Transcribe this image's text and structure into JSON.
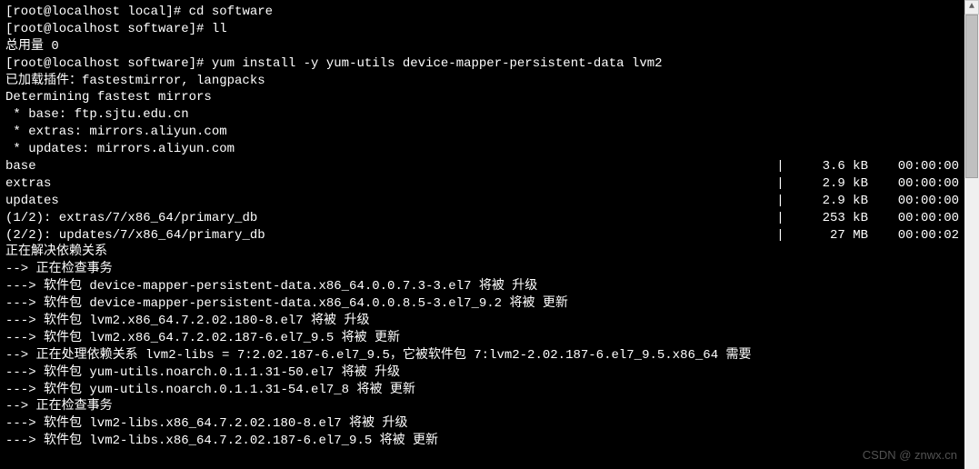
{
  "prompts": {
    "p1_prefix": "[root@localhost local]# ",
    "p1_cmd": "cd software",
    "p2_prefix": "[root@localhost software]# ",
    "p2_cmd": "ll",
    "p3_prefix": "[root@localhost software]# ",
    "p3_cmd": "yum install -y yum-utils device-mapper-persistent-data lvm2"
  },
  "total_usage": "总用量 0",
  "plugins": "已加载插件：fastestmirror, langpacks",
  "determining": "Determining fastest mirrors",
  "mirrors": [
    " * base: ftp.sjtu.edu.cn",
    " * extras: mirrors.aliyun.com",
    " * updates: mirrors.aliyun.com"
  ],
  "repos": [
    {
      "name": "base",
      "size": "3.6 kB",
      "time": "00:00:00"
    },
    {
      "name": "extras",
      "size": "2.9 kB",
      "time": "00:00:00"
    },
    {
      "name": "updates",
      "size": "2.9 kB",
      "time": "00:00:00"
    },
    {
      "name": "(1/2): extras/7/x86_64/primary_db",
      "size": "253 kB",
      "time": "00:00:00"
    },
    {
      "name": "(2/2): updates/7/x86_64/primary_db",
      "size": "27 MB",
      "time": "00:00:02"
    }
  ],
  "resolving": "正在解决依赖关系",
  "trans_check1": "--> 正在检查事务",
  "pkg_lines": [
    "---> 软件包 device-mapper-persistent-data.x86_64.0.0.7.3-3.el7 将被 升级",
    "---> 软件包 device-mapper-persistent-data.x86_64.0.0.8.5-3.el7_9.2 将被 更新",
    "---> 软件包 lvm2.x86_64.7.2.02.180-8.el7 将被 升级",
    "---> 软件包 lvm2.x86_64.7.2.02.187-6.el7_9.5 将被 更新",
    "--> 正在处理依赖关系 lvm2-libs = 7:2.02.187-6.el7_9.5，它被软件包 7:lvm2-2.02.187-6.el7_9.5.x86_64 需要",
    "---> 软件包 yum-utils.noarch.0.1.1.31-50.el7 将被 升级",
    "---> 软件包 yum-utils.noarch.0.1.1.31-54.el7_8 将被 更新",
    "--> 正在检查事务",
    "---> 软件包 lvm2-libs.x86_64.7.2.02.180-8.el7 将被 升级",
    "---> 软件包 lvm2-libs.x86_64.7.2.02.187-6.el7_9.5 将被 更新"
  ],
  "watermark": "CSDN @  znwx.cn"
}
